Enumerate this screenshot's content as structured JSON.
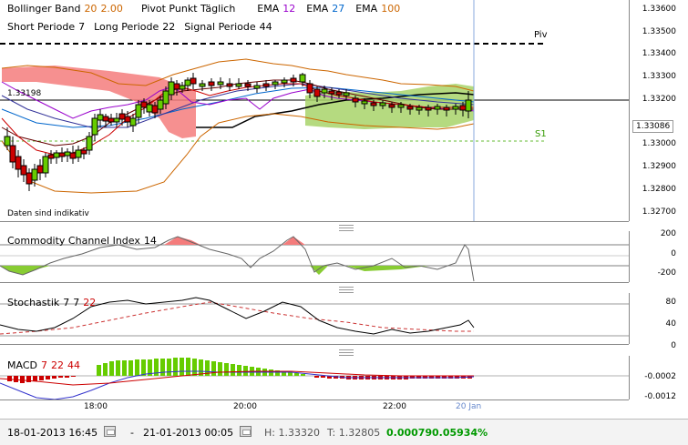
{
  "main_panel": {
    "legend": {
      "bollinger": {
        "label": "Bollinger Band",
        "period": "20",
        "dev": "2.00"
      },
      "pivot": {
        "label": "Pivot Punkt Täglich"
      },
      "ema1": {
        "label": "EMA",
        "value": "12"
      },
      "ema2": {
        "label": "EMA",
        "value": "27"
      },
      "ema3": {
        "label": "EMA",
        "value": "100"
      },
      "short": {
        "label": "Short Periode",
        "value": "7"
      },
      "long": {
        "label": "Long Periode",
        "value": "22"
      },
      "signal": {
        "label": "Signal Periode",
        "value": "44"
      }
    },
    "current_price_left": "1.33198",
    "current_price_right": "1.33086",
    "pivot_label": "Piv",
    "support_label": "S1",
    "disclaimer": "Daten sind indikativ",
    "y_ticks": [
      "1.33600",
      "1.33500",
      "1.33400",
      "1.33300",
      "1.33200",
      "1.33000",
      "1.32900",
      "1.32800",
      "1.32700"
    ]
  },
  "cci_panel": {
    "title": "Commodity Channel Index",
    "period": "14",
    "y_ticks": [
      "200",
      "0",
      "-200"
    ]
  },
  "stoch_panel": {
    "title": "Stochastik",
    "k": "7",
    "d": "7",
    "slow": "22",
    "y_ticks": [
      "80",
      "40",
      "0"
    ]
  },
  "macd_panel": {
    "title": "MACD",
    "fast": "7",
    "slow": "22",
    "signal": "44",
    "y_ticks": [
      "-0.0002",
      "-0.0012"
    ]
  },
  "x_axis": [
    "18:00",
    "20:00",
    "22:00",
    "20 Jan"
  ],
  "status_bar": {
    "from": "18-01-2013 16:45",
    "separator": "-",
    "to": "21-01-2013 00:05",
    "high": "H: 1.33320",
    "low": "T: 1.32805",
    "change": "0.00079",
    "change_pct": "0.05934%"
  },
  "colors": {
    "up": "#66cc00",
    "down": "#cc0000",
    "ema12": "#9900cc",
    "ema27": "#0066cc",
    "ema100": "#cc6600",
    "accent": "#009900"
  }
}
